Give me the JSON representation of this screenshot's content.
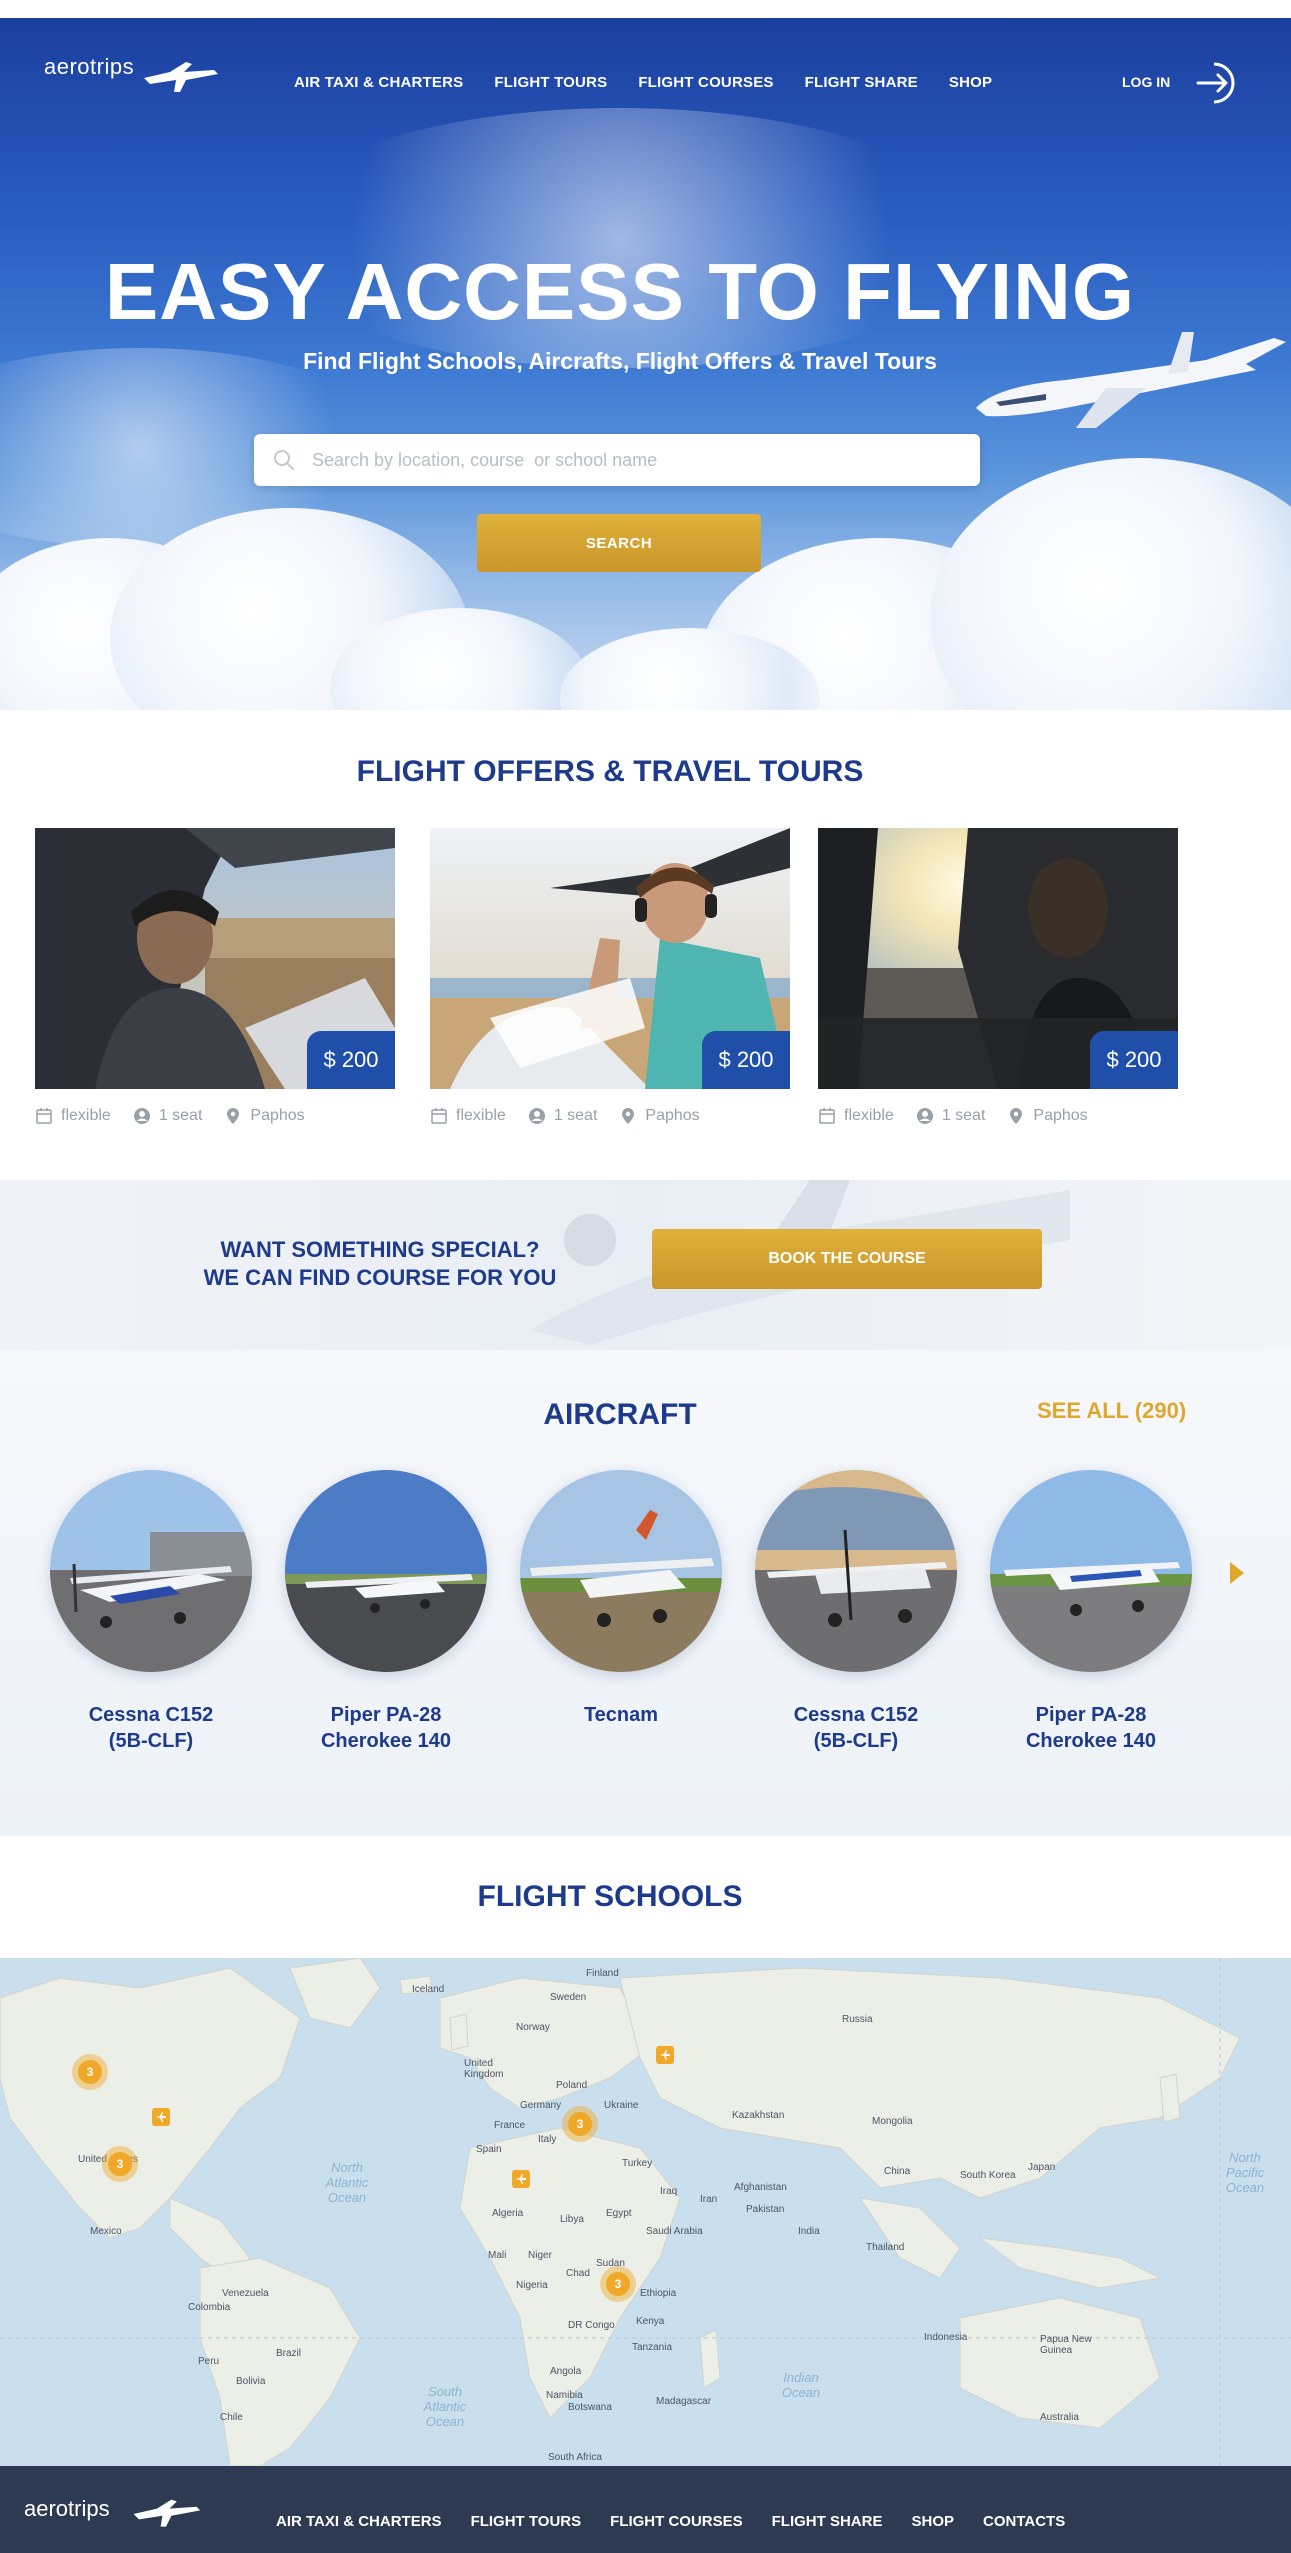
{
  "brand": {
    "logo_text": "aerotrips"
  },
  "nav": {
    "items": [
      "AIR TAXI & CHARTERS",
      "FLIGHT TOURS",
      "FLIGHT COURSES",
      "FLIGHT SHARE",
      "SHOP"
    ],
    "login_label": "LOG IN"
  },
  "hero": {
    "title": "EASY ACCESS TO FLYING",
    "subtitle": "Find Flight Schools, Aircrafts, Flight Offers & Travel Tours",
    "search_placeholder": "Search by location, course  or school name",
    "search_button": "SEARCH"
  },
  "offers": {
    "title": "FLIGHT OFFERS & TRAVEL TOURS",
    "cards": [
      {
        "price": "$ 200",
        "date": "flexible",
        "seats": "1 seat",
        "location": "Paphos"
      },
      {
        "price": "$ 200",
        "date": "flexible",
        "seats": "1 seat",
        "location": "Paphos"
      },
      {
        "price": "$ 200",
        "date": "flexible",
        "seats": "1 seat",
        "location": "Paphos"
      }
    ]
  },
  "cta": {
    "line1": "WANT SOMETHING SPECIAL?",
    "line2": "WE CAN FIND COURSE FOR YOU",
    "button": "BOOK THE COURSE"
  },
  "aircraft": {
    "title": "AIRCRAFT",
    "see_all": "SEE ALL (290)",
    "items": [
      {
        "line1": "Cessna C152",
        "line2": "(5B-CLF)"
      },
      {
        "line1": "Piper PA-28",
        "line2": "Cherokee 140"
      },
      {
        "line1": "Tecnam",
        "line2": ""
      },
      {
        "line1": "Cessna C152",
        "line2": "(5B-CLF)"
      },
      {
        "line1": "Piper PA-28",
        "line2": "Cherokee 140"
      }
    ]
  },
  "schools": {
    "title": "FLIGHT SCHOOLS",
    "cluster_counts": [
      "3",
      "3",
      "3",
      "3"
    ],
    "country_labels": [
      "Iceland",
      "Finland",
      "Sweden",
      "Norway",
      "Russia",
      "United Kingdom",
      "Poland",
      "Germany",
      "Ukraine",
      "France",
      "Italy",
      "Kazakhstan",
      "Mongolia",
      "Spain",
      "Turkey",
      "China",
      "South Korea",
      "Japan",
      "Afghanistan",
      "Pakistan",
      "Iraq",
      "Iran",
      "Algeria",
      "Libya",
      "Egypt",
      "Saudi Arabia",
      "India",
      "Thailand",
      "Mali",
      "Niger",
      "Chad",
      "Sudan",
      "Nigeria",
      "Ethiopia",
      "DR Congo",
      "Kenya",
      "Tanzania",
      "Angola",
      "Namibia",
      "Botswana",
      "Madagascar",
      "South Africa",
      "Indonesia",
      "Papua New Guinea",
      "Australia",
      "Mexico",
      "Venezuela",
      "Colombia",
      "Brazil",
      "Peru",
      "Bolivia",
      "Chile",
      "United States"
    ],
    "ocean_labels": [
      "North Atlantic Ocean",
      "North Pacific Ocean",
      "South Atlantic Ocean",
      "Indian Ocean"
    ]
  },
  "footer": {
    "logo_text": "aerotrips",
    "items": [
      "AIR TAXI & CHARTERS",
      "FLIGHT TOURS",
      "FLIGHT COURSES",
      "FLIGHT SHARE",
      "SHOP",
      "CONTACTS"
    ]
  },
  "colors": {
    "brand_blue": "#1e3a8a",
    "accent_gold": "#d6a233",
    "price_blue": "#1f4fa8",
    "footer_bg": "#2d3a52"
  },
  "icons": [
    "search-icon",
    "login-icon",
    "calendar-icon",
    "user-icon",
    "location-pin-icon",
    "chevron-right-icon",
    "plane-logo-icon"
  ]
}
